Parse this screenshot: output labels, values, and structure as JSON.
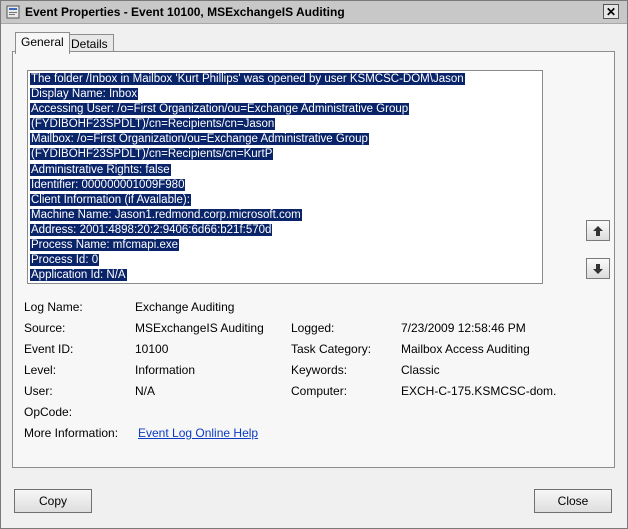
{
  "window": {
    "title": "Event Properties - Event 10100, MSExchangeIS Auditing",
    "close_glyph": "✕"
  },
  "tabs": [
    {
      "label": "General",
      "active": true
    },
    {
      "label": "Details",
      "active": false
    }
  ],
  "description": {
    "lines": [
      "The folder /Inbox in Mailbox 'Kurt Phillips' was opened by user KSMCSC-DOM\\Jason",
      "Display Name: Inbox",
      "Accessing User: /o=First Organization/ou=Exchange Administrative Group",
      "(FYDIBOHF23SPDLT)/cn=Recipients/cn=Jason",
      "Mailbox: /o=First Organization/ou=Exchange Administrative Group",
      "(FYDIBOHF23SPDLT)/cn=Recipients/cn=KurtP",
      "Administrative Rights: false",
      "Identifier: 000000001009F980",
      "Client Information (if Available):",
      "Machine Name: Jason1.redmond.corp.microsoft.com",
      "Address: 2001:4898:20:2:9406:6d66:b21f:570d",
      "Process Name: mfcmapi.exe",
      "Process Id: 0",
      "Application Id: N/A"
    ],
    "selection_color": "#0a246a"
  },
  "scroll_buttons": {
    "up_glyph": "🡅",
    "down_glyph": "🡇"
  },
  "fields": {
    "log_name": {
      "label": "Log Name:",
      "value": "Exchange Auditing"
    },
    "source": {
      "label": "Source:",
      "value": "MSExchangeIS Auditing"
    },
    "logged": {
      "label": "Logged:",
      "value": "7/23/2009 12:58:46 PM"
    },
    "event_id": {
      "label": "Event ID:",
      "value": "10100"
    },
    "task_category": {
      "label": "Task Category:",
      "value": "Mailbox Access Auditing"
    },
    "level": {
      "label": "Level:",
      "value": "Information"
    },
    "keywords": {
      "label": "Keywords:",
      "value": "Classic"
    },
    "user": {
      "label": "User:",
      "value": "N/A"
    },
    "computer": {
      "label": "Computer:",
      "value": "EXCH-C-175.KSMCSC-dom."
    },
    "opcode": {
      "label": "OpCode:",
      "value": ""
    },
    "more_info": {
      "label": "More Information:",
      "link": "Event Log Online Help"
    }
  },
  "buttons": {
    "copy": "Copy",
    "close": "Close"
  }
}
